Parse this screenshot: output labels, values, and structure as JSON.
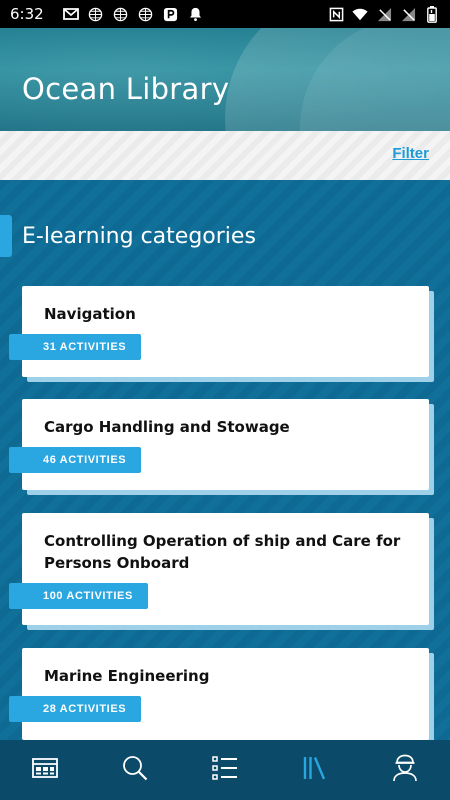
{
  "status_bar": {
    "time": "6:32",
    "left_icons": [
      "gmail-icon",
      "globe-icon",
      "globe-icon",
      "globe-icon",
      "p-icon",
      "bell-icon"
    ],
    "right_icons": [
      "nfc-icon",
      "wifi-icon",
      "signal-off-icon",
      "signal-off-icon",
      "battery-icon"
    ]
  },
  "header": {
    "title": "Ocean Library"
  },
  "filter": {
    "label": "Filter"
  },
  "section": {
    "title": "E-learning categories"
  },
  "categories": [
    {
      "title": "Navigation",
      "badge": "31 ACTIVITIES"
    },
    {
      "title": "Cargo Handling and Stowage",
      "badge": "46 ACTIVITIES"
    },
    {
      "title": "Controlling Operation of ship and Care for Persons Onboard",
      "badge": "100 ACTIVITIES"
    },
    {
      "title": "Marine Engineering",
      "badge": "28 ACTIVITIES"
    }
  ],
  "bottom_nav": {
    "items": [
      "dashboard-icon",
      "search-icon",
      "list-icon",
      "library-icon",
      "profile-icon"
    ],
    "active": "library-icon"
  },
  "colors": {
    "primary": "#0e6a93",
    "accent": "#2aa6e0",
    "nav_bg": "#0b4a68",
    "filter_link": "#1e9bd7"
  }
}
